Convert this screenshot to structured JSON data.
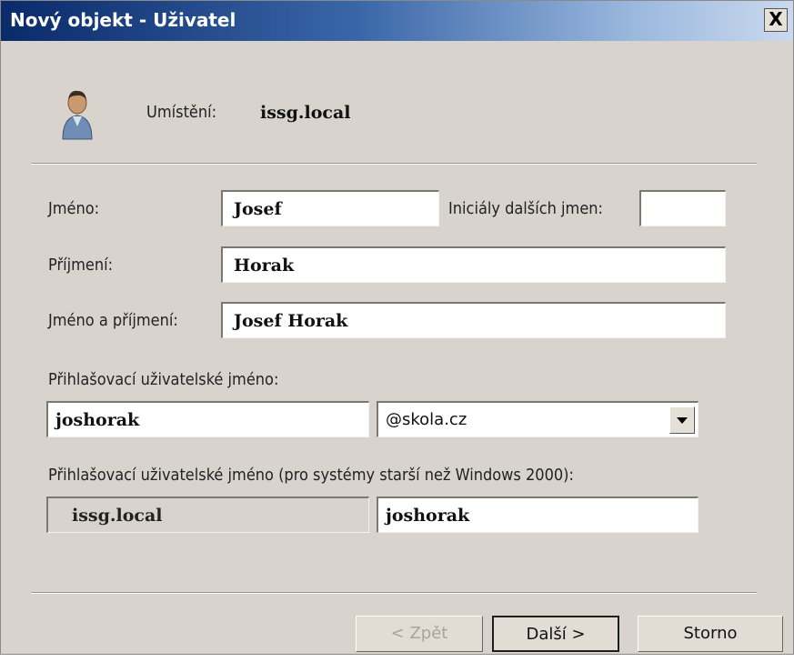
{
  "window": {
    "title": "Nový objekt - Uživatel",
    "close_label": "X"
  },
  "location": {
    "label": "Umístění:",
    "value": "issg.local"
  },
  "form": {
    "first_name": {
      "label": "Jméno:",
      "value": "Josef"
    },
    "initials": {
      "label": "Iniciály dalších jmen:",
      "value": ""
    },
    "last_name": {
      "label": "Příjmení:",
      "value": "Horak"
    },
    "full_name": {
      "label": "Jméno a příjmení:",
      "value": "Josef Horak"
    },
    "logon_name": {
      "label": "Přihlašovací uživatelské jméno:",
      "value": "joshorak",
      "domain_selected": "@skola.cz"
    },
    "pre2000_logon": {
      "label": "Přihlašovací uživatelské jméno (pro systémy starší než Windows 2000):",
      "domain": "issg.local",
      "value": "joshorak"
    }
  },
  "buttons": {
    "back": "< Zpět",
    "next": "Další >",
    "cancel": "Storno"
  },
  "icons": {
    "user": "user-icon",
    "dropdown": "chevron-down-icon"
  }
}
